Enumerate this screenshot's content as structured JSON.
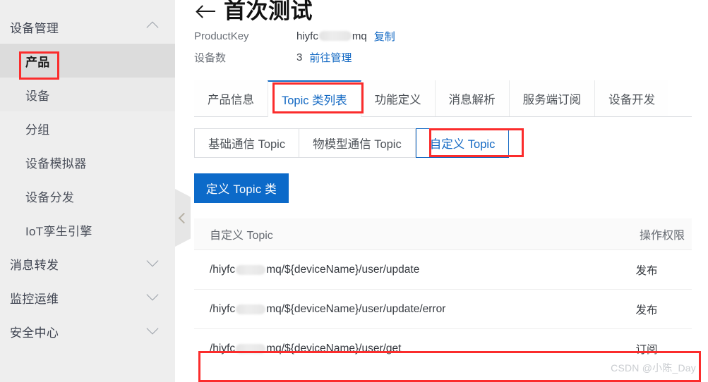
{
  "sidebar": {
    "groups": [
      {
        "label": "设备管理",
        "icon": "chevron-up-icon",
        "expanded": true
      },
      {
        "label": "消息转发",
        "icon": "chevron-down-icon",
        "expanded": false
      },
      {
        "label": "监控运维",
        "icon": "chevron-down-icon",
        "expanded": false
      },
      {
        "label": "安全中心",
        "icon": "chevron-down-icon",
        "expanded": false
      }
    ],
    "items": [
      {
        "label": "产品",
        "selected": true
      },
      {
        "label": "设备",
        "selected": false
      },
      {
        "label": "分组",
        "selected": false
      },
      {
        "label": "设备模拟器",
        "selected": false
      },
      {
        "label": "设备分发",
        "selected": false
      },
      {
        "label": "IoT孪生引擎",
        "selected": false
      }
    ]
  },
  "header": {
    "back_icon": "back-arrow-icon",
    "title": "首次测试",
    "meta": [
      {
        "label": "ProductKey",
        "value_prefix": "hiyfc",
        "value_suffix": "mq",
        "masked": true,
        "link": "复制"
      },
      {
        "label": "设备数",
        "value": "3",
        "link": "前往管理"
      }
    ]
  },
  "tabs": {
    "items": [
      {
        "label": "产品信息",
        "active": false
      },
      {
        "label": "Topic 类列表",
        "active": true
      },
      {
        "label": "功能定义",
        "active": false
      },
      {
        "label": "消息解析",
        "active": false
      },
      {
        "label": "服务端订阅",
        "active": false
      },
      {
        "label": "设备开发",
        "active": false
      }
    ]
  },
  "subtabs": {
    "items": [
      {
        "label": "基础通信 Topic",
        "active": false
      },
      {
        "label": "物模型通信 Topic",
        "active": false
      },
      {
        "label": "自定义 Topic",
        "active": true
      }
    ]
  },
  "actions": {
    "define_topic_button": "定义 Topic 类"
  },
  "table": {
    "columns": [
      "自定义 Topic",
      "操作权限"
    ],
    "rows": [
      {
        "topic_prefix": "/hiyfc",
        "topic_suffix": "mq/${deviceName}/user/update",
        "masked": true,
        "permission": "发布"
      },
      {
        "topic_prefix": "/hiyfc",
        "topic_suffix": "mq/${deviceName}/user/update/error",
        "masked": true,
        "permission": "发布"
      },
      {
        "topic_prefix": "/hiyfc",
        "topic_suffix": "mq/${deviceName}/user/get",
        "masked": true,
        "permission": "订阅"
      }
    ]
  },
  "collapse_handle": {
    "icon": "chevron-left-icon"
  },
  "watermark": {
    "text": "CSDN @小陈_Day"
  },
  "colors": {
    "accent_blue": "#1268c3",
    "button_blue": "#0c6ac9",
    "annotation_red": "#fb2c2c",
    "sidebar_bg": "#eeeeee",
    "sidebar_selected_bg": "#dcdcdc"
  }
}
